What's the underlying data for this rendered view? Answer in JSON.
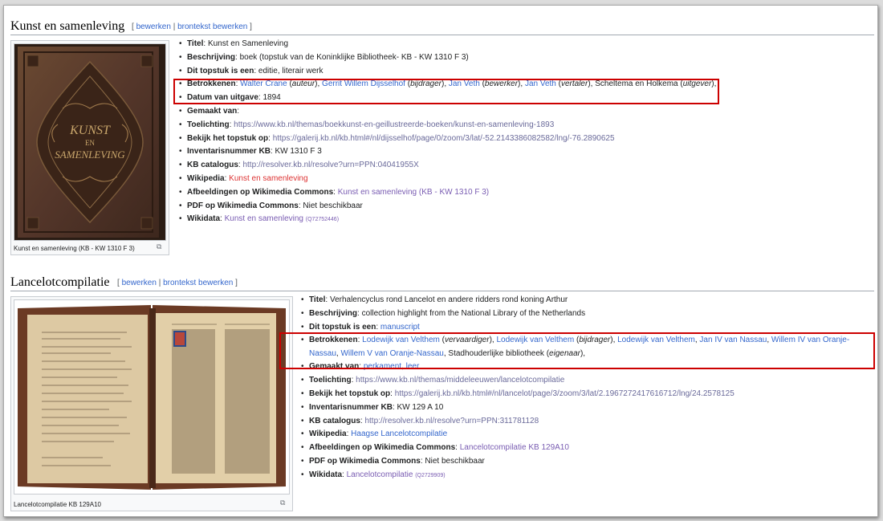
{
  "edit_links": {
    "open": "[",
    "edit": "bewerken",
    "sep": "|",
    "source": "brontekst bewerken",
    "close": "]"
  },
  "sections": [
    {
      "title": "Kunst en samenleving",
      "caption": "Kunst en samenleving (KB - KW 1310 F 3)",
      "book_cover_text": {
        "line1": "KUNST",
        "line2": "EN",
        "line3": "SAMENLEVING"
      },
      "props": {
        "titel": {
          "label": "Titel",
          "value": "Kunst en Samenleving"
        },
        "beschrijving": {
          "label": "Beschrijving",
          "value": "boek (topstuk van de Koninklijke Bibliotheek- KB - KW 1310 F 3)"
        },
        "topstuk": {
          "label": "Dit topstuk is een",
          "value": "editie, literair werk"
        },
        "betrokkenen": {
          "label": "Betrokkenen",
          "p1": "Walter Crane",
          "r1": "auteur",
          "p2": "Gerrit Willem Dijsselhof",
          "r2": "bijdrager",
          "p3": "Jan Veth",
          "r3": "bewerker",
          "p4": "Jan Veth",
          "r4": "vertaler",
          "p5": "Scheltema en Holkema",
          "r5": "uitgever"
        },
        "datum": {
          "label": "Datum van uitgave",
          "value": "1894"
        },
        "gemaakt": {
          "label": "Gemaakt van",
          "value": ""
        },
        "toelichting": {
          "label": "Toelichting",
          "value": "https://www.kb.nl/themas/boekkunst-en-geillustreerde-boeken/kunst-en-samenleving-1893"
        },
        "bekijk": {
          "label": "Bekijk het topstuk op",
          "value": "https://galerij.kb.nl/kb.html#/nl/dijsselhof/page/0/zoom/3/lat/-52.2143386082582/lng/-76.2890625"
        },
        "inventaris": {
          "label": "Inventarisnummer KB",
          "value": "KW 1310 F 3"
        },
        "catalogus": {
          "label": "KB catalogus",
          "value": "http://resolver.kb.nl/resolve?urn=PPN:04041955X"
        },
        "wikipedia": {
          "label": "Wikipedia",
          "value": "Kunst en samenleving"
        },
        "commons": {
          "label": "Afbeeldingen op Wikimedia Commons",
          "value": "Kunst en samenleving (KB - KW 1310 F 3)"
        },
        "pdf": {
          "label": "PDF op Wikimedia Commons",
          "value": "Niet beschikbaar"
        },
        "wikidata": {
          "label": "Wikidata",
          "value": "Kunst en samenleving",
          "qid": "(Q72752446)"
        }
      }
    },
    {
      "title": "Lancelotcompilatie",
      "caption": "Lancelotcompilatie KB 129A10",
      "props": {
        "titel": {
          "label": "Titel",
          "value": "Verhalencyclus rond Lancelot en andere ridders rond koning Arthur"
        },
        "beschrijving": {
          "label": "Beschrijving",
          "value": "collection highlight from the National Library of the Netherlands"
        },
        "topstuk": {
          "label": "Dit topstuk is een",
          "value": "manuscript"
        },
        "betrokkenen": {
          "label": "Betrokkenen",
          "p1": "Lodewijk van Velthem",
          "r1": "vervaardiger",
          "p2": "Lodewijk van Velthem",
          "r2": "bijdrager",
          "p3": "Lodewijk van Velthem",
          "p4": "Jan IV van Nassau",
          "p5": "Willem IV van Oranje-Nassau",
          "p6": "Willem V van Oranje-Nassau",
          "p7": "Stadhouderlijke bibliotheek",
          "r7": "eigenaar"
        },
        "gemaakt": {
          "label": "Gemaakt van",
          "v1": "perkament",
          "v2": "leer"
        },
        "toelichting": {
          "label": "Toelichting",
          "value": "https://www.kb.nl/themas/middeleeuwen/lancelotcompilatie"
        },
        "bekijk": {
          "label": "Bekijk het topstuk op",
          "value": "https://galerij.kb.nl/kb.html#/nl/lancelot/page/3/zoom/3/lat/2.1967272417616712/lng/24.2578125"
        },
        "inventaris": {
          "label": "Inventarisnummer KB",
          "value": "KW 129 A 10"
        },
        "catalogus": {
          "label": "KB catalogus",
          "value": "http://resolver.kb.nl/resolve?urn=PPN:311781128"
        },
        "wikipedia": {
          "label": "Wikipedia",
          "value": "Haagse Lancelotcompilatie"
        },
        "commons": {
          "label": "Afbeeldingen op Wikimedia Commons",
          "value": "Lancelotcompilatie KB 129A10"
        },
        "pdf": {
          "label": "PDF op Wikimedia Commons",
          "value": "Niet beschikbaar"
        },
        "wikidata": {
          "label": "Wikidata",
          "value": "Lancelotcompilatie",
          "qid": "(Q2729909)"
        }
      }
    }
  ],
  "colors": {
    "link": "#3366cc",
    "visited": "#795cb2",
    "redlink": "#d33",
    "highlight": "#c00"
  },
  "icons": {
    "magnify": "magnify-icon"
  }
}
